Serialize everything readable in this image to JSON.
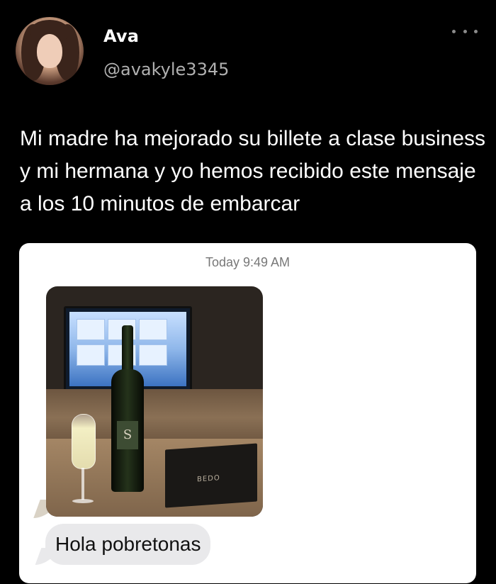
{
  "tweet": {
    "author": {
      "name": "Ava",
      "handle": "@avakyle3345"
    },
    "text": "Mi madre ha mejorado su billete a clase business y mi hermana y yo hemos recibido este mensaje a los 10 minutos de embarcar",
    "attachment": {
      "timestamp": "Today 9:49 AM",
      "message_text": "Hola pobretonas",
      "bottle_label": "S",
      "menu_card_text": "BEDO"
    }
  }
}
